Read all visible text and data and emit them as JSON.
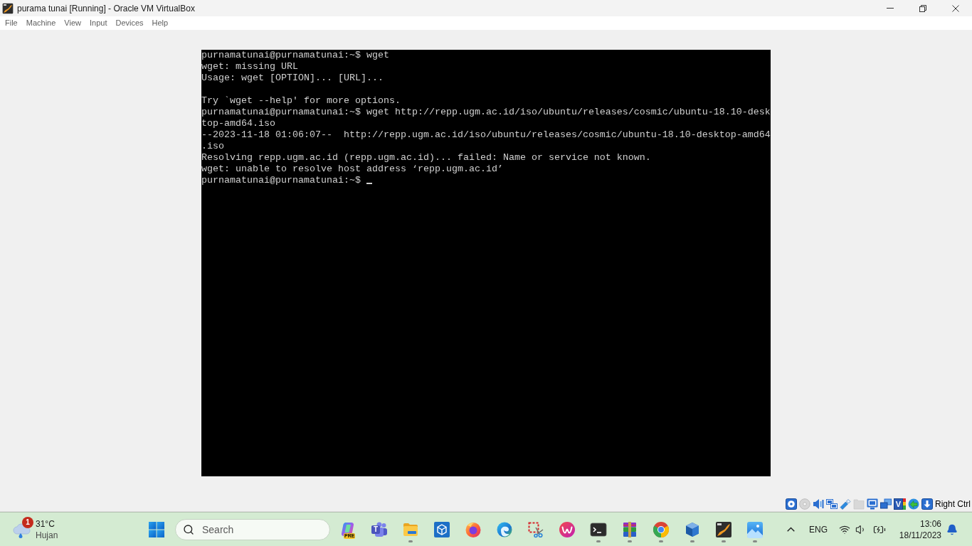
{
  "window": {
    "title": "purama tunai [Running] - Oracle VM VirtualBox"
  },
  "menu": [
    "File",
    "Machine",
    "View",
    "Input",
    "Devices",
    "Help"
  ],
  "terminal": {
    "blocks": [
      [
        "purnamatunai@purnamatunai:~$ wget",
        "wget: missing URL",
        "Usage: wget [OPTION]... [URL]..."
      ],
      [
        "Try `wget --help' for more options.",
        "purnamatunai@purnamatunai:~$ wget http://repp.ugm.ac.id/iso/ubuntu/releases/cosmic/ubuntu-18.10-desk",
        "top-amd64.iso",
        "--2023-11-18 01:06:07--  http://repp.ugm.ac.id/iso/ubuntu/releases/cosmic/ubuntu-18.10-desktop-amd64",
        ".iso",
        "Resolving repp.ugm.ac.id (repp.ugm.ac.id)... failed: Name or service not known.",
        "wget: unable to resolve host address ‘repp.ugm.ac.id’",
        "purnamatunai@purnamatunai:~$"
      ]
    ]
  },
  "status_bar": {
    "icons": [
      {
        "kind": "disk",
        "disabled": false
      },
      {
        "kind": "optical",
        "disabled": true
      },
      {
        "kind": "audio",
        "disabled": false
      },
      {
        "kind": "network",
        "disabled": false
      },
      {
        "kind": "usb",
        "disabled": false
      },
      {
        "kind": "shared",
        "disabled": true
      },
      {
        "kind": "display",
        "disabled": false
      },
      {
        "kind": "capture",
        "disabled": false
      },
      {
        "kind": "recording",
        "glyph": "V",
        "disabled": false
      },
      {
        "kind": "mouse",
        "disabled": false
      },
      {
        "kind": "keyboard",
        "disabled": false
      }
    ],
    "host_key": "Right Ctrl"
  },
  "taskbar": {
    "weather": {
      "notifications": "1",
      "temperature": "31°C",
      "condition": "Hujan"
    },
    "search": {
      "placeholder": "Search"
    },
    "apps": [
      {
        "kind": "copilot",
        "label": "PRE",
        "running": false
      },
      {
        "kind": "teams",
        "label": "T",
        "running": false
      },
      {
        "kind": "explorer",
        "running": true
      },
      {
        "kind": "cube",
        "running": false
      },
      {
        "kind": "firefox",
        "running": false
      },
      {
        "kind": "edge",
        "running": false
      },
      {
        "kind": "snipping",
        "running": false
      },
      {
        "kind": "wps",
        "running": false
      },
      {
        "kind": "terminal",
        "running": true
      },
      {
        "kind": "archive",
        "running": true
      },
      {
        "kind": "chrome",
        "running": true
      },
      {
        "kind": "virtualbox",
        "running": true
      },
      {
        "kind": "vm",
        "running": true
      },
      {
        "kind": "photos",
        "running": true
      }
    ],
    "tray": {
      "language": "ENG",
      "time": "13:06",
      "date": "18/11/2023"
    }
  }
}
